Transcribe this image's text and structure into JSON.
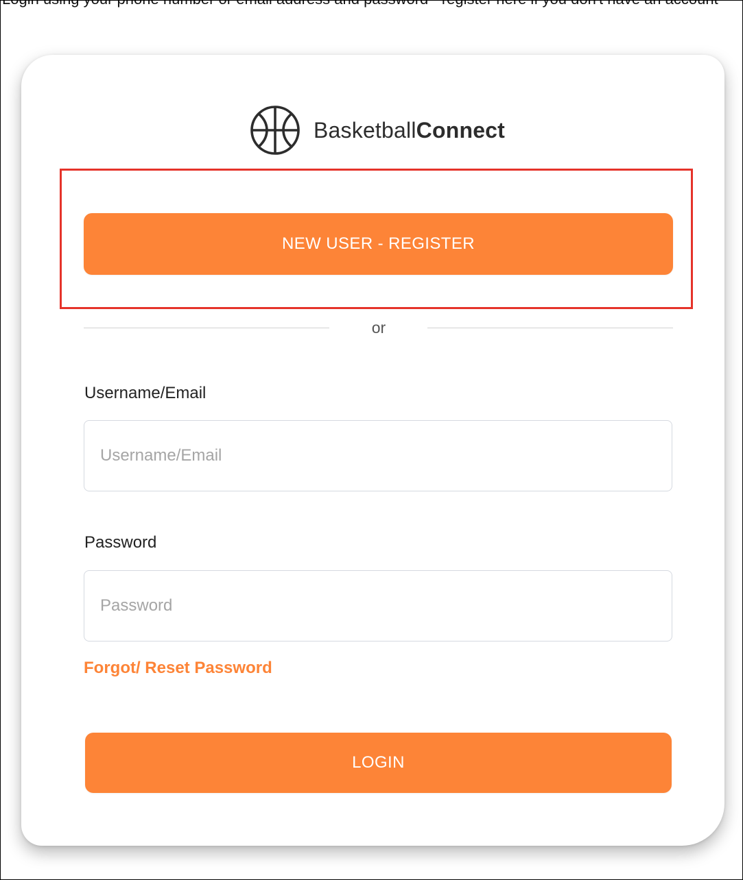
{
  "instruction_text": "Login using your phone number or email address and password - register here if you don't have an account",
  "brand": {
    "name_regular": "Basketball",
    "name_bold": "Connect",
    "icon": "basketball-icon"
  },
  "register_button": {
    "label": "NEW USER - REGISTER"
  },
  "divider": {
    "label": "or"
  },
  "username": {
    "label": "Username/Email",
    "placeholder": "Username/Email",
    "value": ""
  },
  "password": {
    "label": "Password",
    "placeholder": "Password",
    "value": ""
  },
  "forgot_link": {
    "label": "Forgot/ Reset Password"
  },
  "login_button": {
    "label": "LOGIN"
  },
  "colors": {
    "accent": "#fd8437",
    "highlight_box": "#e5332a",
    "input_border": "#d5d9e0"
  }
}
